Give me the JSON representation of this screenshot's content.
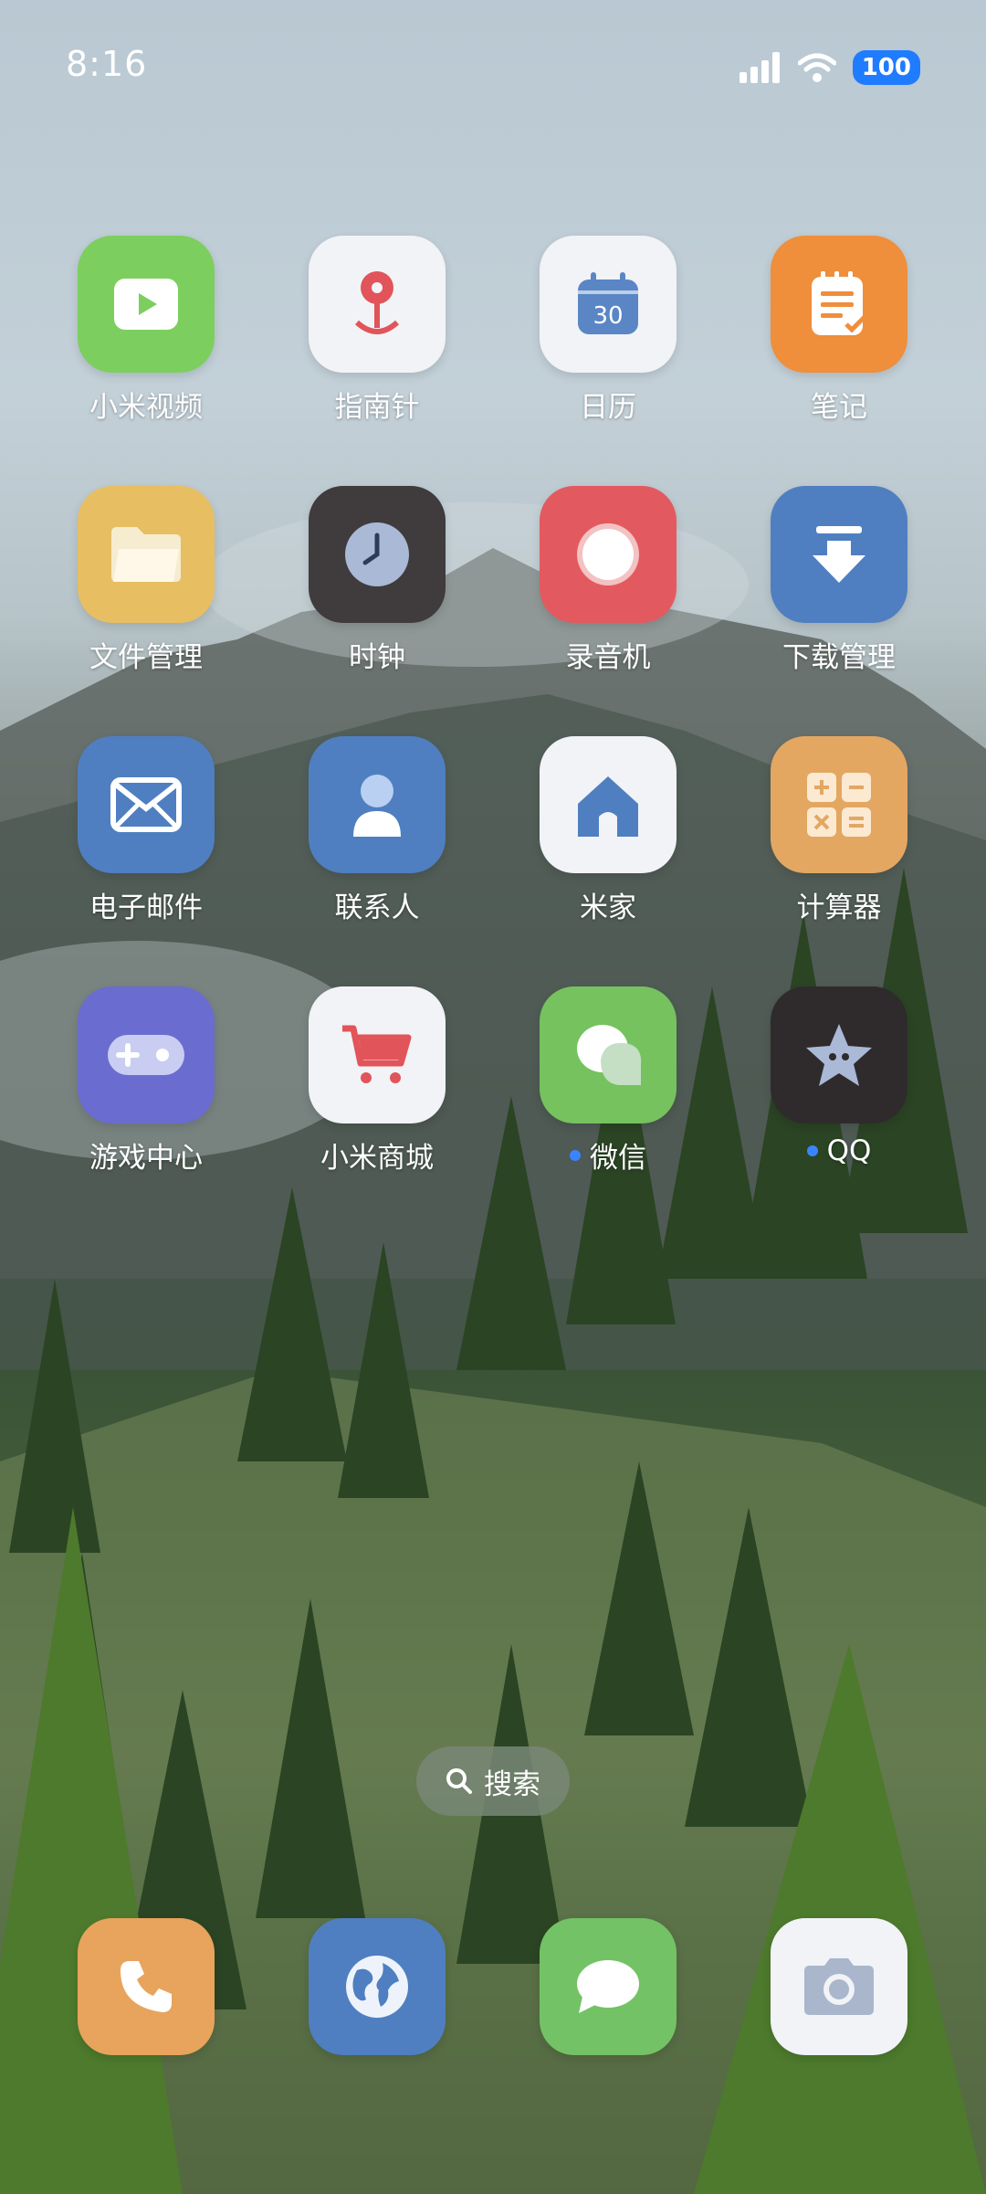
{
  "status_bar": {
    "time": "8:16",
    "battery": "100",
    "icons": [
      "signal-icon",
      "wifi-icon",
      "battery-icon"
    ]
  },
  "apps": [
    {
      "label": "小米视频",
      "icon": "video-play-icon",
      "color": "#7ccf5e"
    },
    {
      "label": "指南针",
      "icon": "compass-pin-icon",
      "color": "#f1f3f6"
    },
    {
      "label": "日历",
      "icon": "calendar-icon",
      "color": "#f1f3f6",
      "calendar_day": "30"
    },
    {
      "label": "笔记",
      "icon": "notes-icon",
      "color": "#ef8e3b"
    },
    {
      "label": "文件管理",
      "icon": "folder-icon",
      "color": "#e8be63"
    },
    {
      "label": "时钟",
      "icon": "clock-icon",
      "color": "#403b3c"
    },
    {
      "label": "录音机",
      "icon": "recorder-icon",
      "color": "#e25a5f"
    },
    {
      "label": "下载管理",
      "icon": "download-icon",
      "color": "#4f7fc1"
    },
    {
      "label": "电子邮件",
      "icon": "mail-icon",
      "color": "#4f7fc1"
    },
    {
      "label": "联系人",
      "icon": "contacts-icon",
      "color": "#4f7fc1"
    },
    {
      "label": "米家",
      "icon": "home-icon",
      "color": "#f1f3f6"
    },
    {
      "label": "计算器",
      "icon": "calculator-icon",
      "color": "#e3a762"
    },
    {
      "label": "游戏中心",
      "icon": "gamepad-icon",
      "color": "#6a6ccf"
    },
    {
      "label": "小米商城",
      "icon": "cart-icon",
      "color": "#f1f3f6"
    },
    {
      "label": "微信",
      "icon": "chat-bubbles-icon",
      "color": "#75c25f",
      "badge_dot": true
    },
    {
      "label": "QQ",
      "icon": "qq-star-icon",
      "color": "#2f2b2c",
      "badge_dot": true
    }
  ],
  "search": {
    "label": "搜索"
  },
  "dock": [
    {
      "icon": "phone-icon",
      "color": "#e8a45c"
    },
    {
      "icon": "browser-globe-icon",
      "color": "#4f7fc1"
    },
    {
      "icon": "messages-icon",
      "color": "#74c266"
    },
    {
      "icon": "camera-icon",
      "color": "#f1f3f6"
    }
  ]
}
